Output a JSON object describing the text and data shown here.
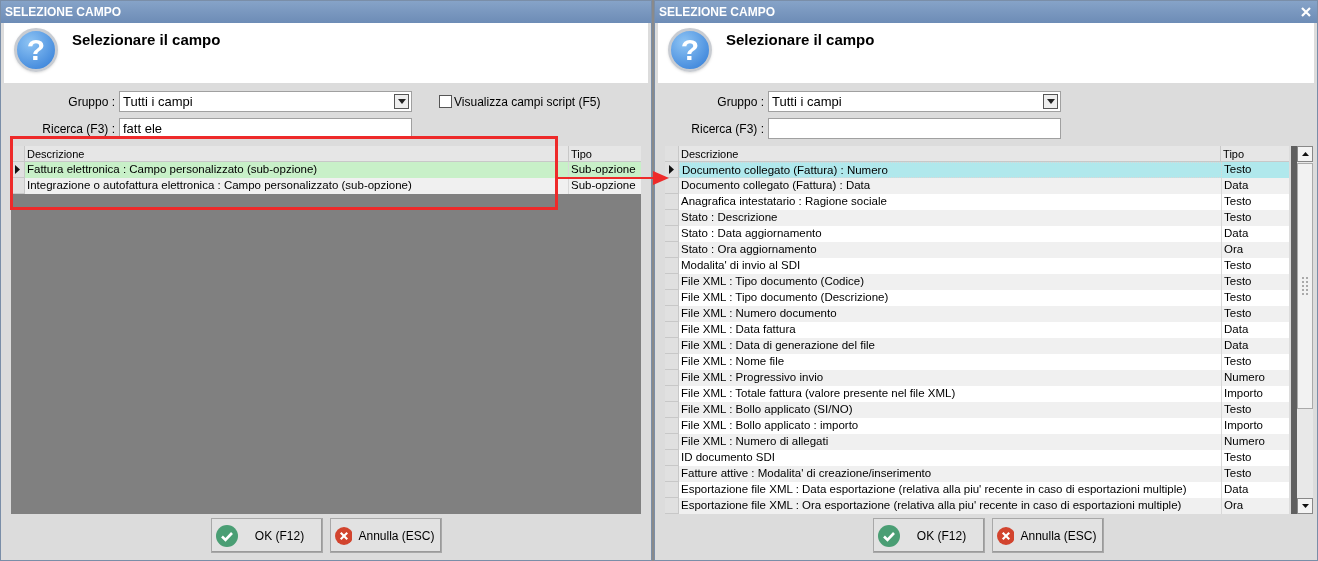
{
  "dialogs": [
    {
      "title": "SELEZIONE CAMPO",
      "close_button": false,
      "icon_glyph": "?",
      "heading": "Selezionare il campo",
      "group_label": "Gruppo :",
      "group_value": "Tutti i campi",
      "search_label": "Ricerca (F3) :",
      "search_value": "fatt ele",
      "script_checkbox": {
        "label": "Visualizza campi script (F5)",
        "checked": false
      },
      "focused": false,
      "scrollbar": false,
      "columns": [
        "Descrizione",
        "Tipo"
      ],
      "rows": [
        {
          "description": "Fattura elettronica : Campo personalizzato (sub-opzione)",
          "type": "Sub-opzione",
          "selected": true
        },
        {
          "description": "Integrazione o autofattura elettronica : Campo personalizzato (sub-opzione)",
          "type": "Sub-opzione",
          "selected": false
        }
      ],
      "buttons": [
        {
          "kind": "ok",
          "label": "OK (F12)"
        },
        {
          "kind": "cancel",
          "label": "Annulla (ESC)"
        }
      ]
    },
    {
      "title": "SELEZIONE CAMPO",
      "close_button": true,
      "icon_glyph": "?",
      "heading": "Selezionare il campo",
      "group_label": "Gruppo :",
      "group_value": "Tutti i campi",
      "search_label": "Ricerca (F3) :",
      "focused": true,
      "scrollbar": true,
      "columns": [
        "Descrizione",
        "Tipo"
      ],
      "rows": [
        {
          "description": "Documento collegato (Fattura) : Numero",
          "type": "Testo",
          "selected": true
        },
        {
          "description": "Documento collegato (Fattura) : Data",
          "type": "Data",
          "selected": false
        },
        {
          "description": "Anagrafica intestatario : Ragione sociale",
          "type": "Testo",
          "selected": false
        },
        {
          "description": "Stato : Descrizione",
          "type": "Testo",
          "selected": false
        },
        {
          "description": "Stato : Data aggiornamento",
          "type": "Data",
          "selected": false
        },
        {
          "description": "Stato : Ora aggiornamento",
          "type": "Ora",
          "selected": false
        },
        {
          "description": "Modalita' di invio al SDI",
          "type": "Testo",
          "selected": false
        },
        {
          "description": "File XML : Tipo documento (Codice)",
          "type": "Testo",
          "selected": false
        },
        {
          "description": "File XML : Tipo documento (Descrizione)",
          "type": "Testo",
          "selected": false
        },
        {
          "description": "File XML : Numero documento",
          "type": "Testo",
          "selected": false
        },
        {
          "description": "File XML : Data fattura",
          "type": "Data",
          "selected": false
        },
        {
          "description": "File XML : Data di generazione del file",
          "type": "Data",
          "selected": false
        },
        {
          "description": "File XML : Nome file",
          "type": "Testo",
          "selected": false
        },
        {
          "description": "File XML : Progressivo invio",
          "type": "Numero",
          "selected": false
        },
        {
          "description": "File XML : Totale fattura (valore presente nel file XML)",
          "type": "Importo",
          "selected": false
        },
        {
          "description": "File XML : Bollo applicato (SI/NO)",
          "type": "Testo",
          "selected": false
        },
        {
          "description": "File XML : Bollo applicato : importo",
          "type": "Importo",
          "selected": false
        },
        {
          "description": "File XML : Numero di allegati",
          "type": "Numero",
          "selected": false
        },
        {
          "description": "ID documento SDI",
          "type": "Testo",
          "selected": false
        },
        {
          "description": "Fatture attive : Modalita' di creazione/inserimento",
          "type": "Testo",
          "selected": false
        },
        {
          "description": "Esportazione file XML : Data esportazione (relativa alla piu' recente in caso di esportazioni multiple)",
          "type": "Data",
          "selected": false
        },
        {
          "description": "Esportazione file XML : Ora esportazione (relativa alla piu' recente in caso di esportazioni multiple)",
          "type": "Ora",
          "selected": false
        }
      ],
      "buttons": [
        {
          "kind": "ok",
          "label": "OK (F12)"
        },
        {
          "kind": "cancel",
          "label": "Annulla (ESC)"
        }
      ]
    }
  ],
  "annotation": {
    "highlight_frame": true,
    "arrow": true
  }
}
